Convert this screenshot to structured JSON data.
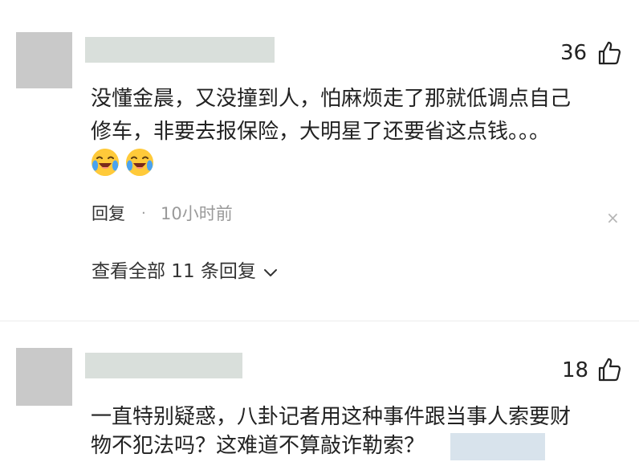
{
  "comments": [
    {
      "likes": "36",
      "text_line1": "没懂金晨，又没撞到人，怕麻烦走了那就低调点自己",
      "text_line2": "修车，非要去报保险，大明星了还要省这点钱。。。",
      "emoji_icon": "laughing-crying-face-icon",
      "reply_label": "回复",
      "separator": "·",
      "time": "10小时前",
      "close_label": "×",
      "view_replies_label": "查看全部 11 条回复",
      "chevron": "∨"
    },
    {
      "likes": "18",
      "text_line1": "一直特别疑惑，八卦记者用这种事件跟当事人索要财",
      "text_line2": "物不犯法吗？这难道不算敲诈勒索？"
    }
  ],
  "colors": {
    "avatar": "#c9c9c9",
    "name_placeholder": "#d9dfdb",
    "redaction": "#d8e3ec",
    "secondary_text": "#9a9a9a",
    "primary_text": "#222222"
  }
}
